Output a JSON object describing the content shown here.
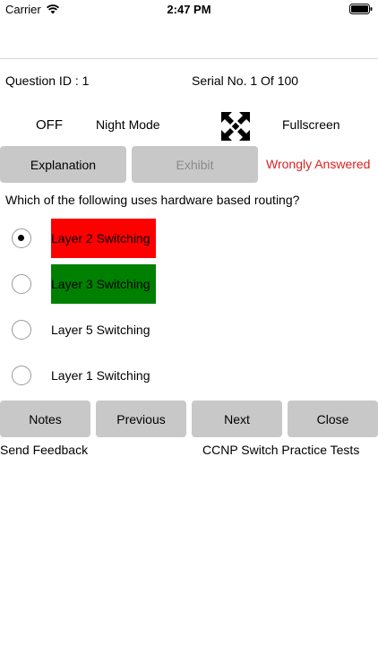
{
  "status_bar": {
    "carrier": "Carrier",
    "time": "2:47 PM"
  },
  "info": {
    "question_id": "Question ID : 1",
    "serial": "Serial No. 1 Of 100"
  },
  "controls": {
    "night_mode_state": "OFF",
    "night_mode_label": "Night Mode",
    "fullscreen_label": "Fullscreen"
  },
  "buttons": {
    "explanation": "Explanation",
    "exhibit": "Exhibit"
  },
  "result": {
    "text": "Wrongly Answered",
    "color": "#e02020"
  },
  "question": {
    "text": "Which of the following uses hardware based routing?"
  },
  "options": [
    {
      "label": "Layer 2 Switching",
      "selected": true,
      "highlight": "#ff0000"
    },
    {
      "label": "Layer 3 Switching",
      "selected": false,
      "highlight": "#008000"
    },
    {
      "label": "Layer 5 Switching",
      "selected": false,
      "highlight": ""
    },
    {
      "label": "Layer 1 Switching",
      "selected": false,
      "highlight": ""
    }
  ],
  "nav": {
    "notes": "Notes",
    "previous": "Previous",
    "next": "Next",
    "close": "Close"
  },
  "footer": {
    "feedback": "Send Feedback",
    "app_name": "CCNP Switch Practice Tests"
  },
  "icons": {
    "wifi": "wifi-icon",
    "battery": "battery-icon",
    "fullscreen": "fullscreen-icon"
  }
}
